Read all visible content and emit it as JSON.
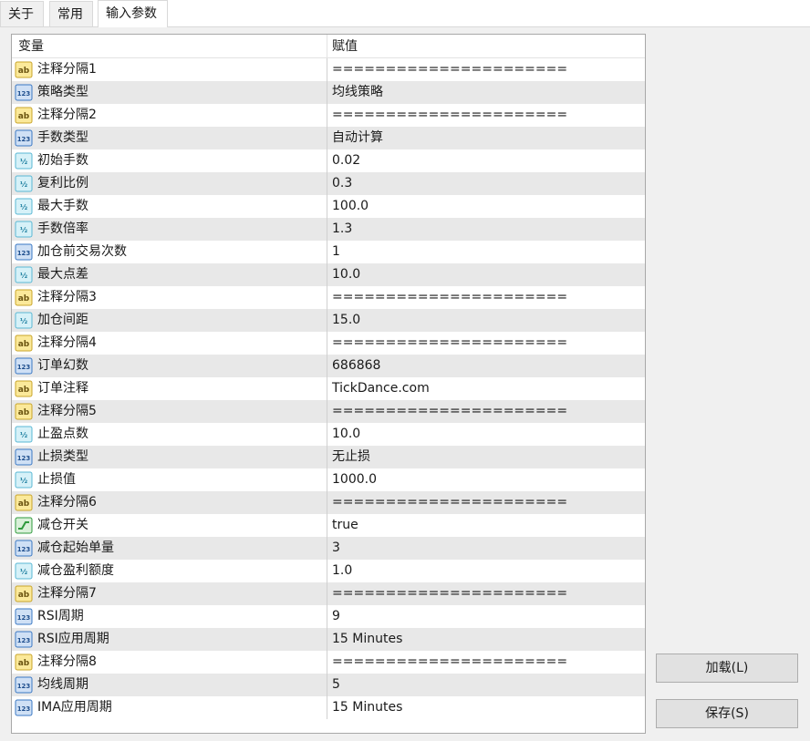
{
  "tabs": [
    {
      "label": "关于"
    },
    {
      "label": "常用"
    },
    {
      "label": "输入参数"
    }
  ],
  "grid": {
    "headers": {
      "variable": "变量",
      "value": "赋值"
    },
    "rows": [
      {
        "name": "注释分隔1",
        "value": "======================",
        "icon": "ab-string-icon"
      },
      {
        "name": "策略类型",
        "value": "均线策略",
        "icon": "123-integer-icon"
      },
      {
        "name": "注释分隔2",
        "value": "======================",
        "icon": "ab-string-icon"
      },
      {
        "name": "手数类型",
        "value": "自动计算",
        "icon": "123-integer-icon"
      },
      {
        "name": "初始手数",
        "value": "0.02",
        "icon": "fraction-double-icon"
      },
      {
        "name": "复利比例",
        "value": "0.3",
        "icon": "fraction-double-icon"
      },
      {
        "name": "最大手数",
        "value": "100.0",
        "icon": "fraction-double-icon"
      },
      {
        "name": "手数倍率",
        "value": "1.3",
        "icon": "fraction-double-icon"
      },
      {
        "name": "加仓前交易次数",
        "value": "1",
        "icon": "123-integer-icon"
      },
      {
        "name": "最大点差",
        "value": "10.0",
        "icon": "fraction-double-icon"
      },
      {
        "name": "注释分隔3",
        "value": "======================",
        "icon": "ab-string-icon"
      },
      {
        "name": "加仓间距",
        "value": "15.0",
        "icon": "fraction-double-icon"
      },
      {
        "name": "注释分隔4",
        "value": "======================",
        "icon": "ab-string-icon"
      },
      {
        "name": "订单幻数",
        "value": "686868",
        "icon": "123-integer-icon"
      },
      {
        "name": "订单注释",
        "value": "TickDance.com",
        "icon": "ab-string-icon"
      },
      {
        "name": "注释分隔5",
        "value": "======================",
        "icon": "ab-string-icon"
      },
      {
        "name": "止盈点数",
        "value": "10.0",
        "icon": "fraction-double-icon"
      },
      {
        "name": "止损类型",
        "value": "无止损",
        "icon": "123-integer-icon"
      },
      {
        "name": "止损值",
        "value": "1000.0",
        "icon": "fraction-double-icon"
      },
      {
        "name": "注释分隔6",
        "value": "======================",
        "icon": "ab-string-icon"
      },
      {
        "name": "减仓开关",
        "value": "true",
        "icon": "bool-toggle-icon"
      },
      {
        "name": "减仓起始单量",
        "value": "3",
        "icon": "123-integer-icon"
      },
      {
        "name": "减仓盈利额度",
        "value": "1.0",
        "icon": "fraction-double-icon"
      },
      {
        "name": "注释分隔7",
        "value": "======================",
        "icon": "ab-string-icon"
      },
      {
        "name": "RSI周期",
        "value": "9",
        "icon": "123-integer-icon"
      },
      {
        "name": "RSI应用周期",
        "value": "15 Minutes",
        "icon": "123-integer-icon"
      },
      {
        "name": "注释分隔8",
        "value": "======================",
        "icon": "ab-string-icon"
      },
      {
        "name": "均线周期",
        "value": "5",
        "icon": "123-integer-icon"
      },
      {
        "name": "IMA应用周期",
        "value": "15 Minutes",
        "icon": "123-integer-icon"
      }
    ]
  },
  "buttons": {
    "load": "加载(L)",
    "save": "保存(S)"
  },
  "colors": {
    "row_alt": "#e8e8e8",
    "icon_ab": "#e8c840",
    "icon_123": "#3a78c4",
    "icon_fraction": "#5ab8d4",
    "icon_bool": "#2e9a3c"
  }
}
